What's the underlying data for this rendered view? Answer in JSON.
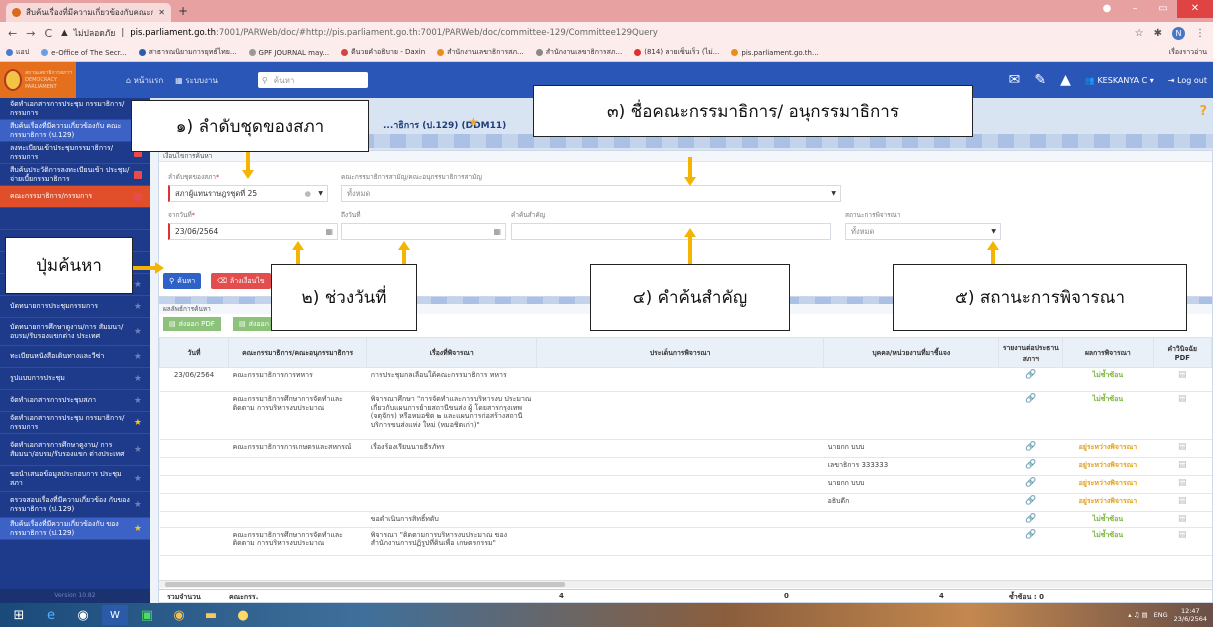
{
  "browser": {
    "tab_title": "สืบค้นเรื่องที่มีความเกี่ยวข้องกับคณะกรร...",
    "new_tab": "+",
    "window_controls": [
      "●",
      "–",
      "▭",
      "✕"
    ],
    "nav": [
      "←",
      "→",
      "C"
    ],
    "security": "ไม่ปลอดภัย",
    "url_host": "pis.parliament.go.th",
    "url_path": ":7001/PARWeb/doc/#http://pis.parliament.go.th:7001/PARWeb/doc/committee-129/Committee129Query",
    "profile": "N",
    "bookmarks": [
      {
        "label": "แอป",
        "color": "#4a7bd0"
      },
      {
        "label": "e-Office of The Secr...",
        "color": "#6aa0e0"
      },
      {
        "label": "สาธารณนิยามการยุทธ์ไทย...",
        "color": "#2a5fb0"
      },
      {
        "label": "GPF JOURNAL may...",
        "color": "#999999"
      },
      {
        "label": "ดีนวยคำอธิบาย - Daxin",
        "color": "#d04444"
      },
      {
        "label": "สำนักงานเลขาธิการสภ...",
        "color": "#e88e1e"
      },
      {
        "label": "สำนักงานเลขาธิการสภ...",
        "color": "#888888"
      },
      {
        "label": "(814) ลายเซ็นเร็ว (ไม่...",
        "color": "#e03030"
      },
      {
        "label": "pis.parliament.go.th...",
        "color": "#e88e1e"
      }
    ],
    "reading_list": "เรื่องราวอ่าน"
  },
  "app_header": {
    "logo_text": [
      "สถานเลขาธิการสภาฯ",
      "DEMOCRACY PARLIAMENT"
    ],
    "nav": [
      "หน้าแรก",
      "ระบบงาน"
    ],
    "search_placeholder": "ค้นหา",
    "user": "KESKANYA C",
    "logout": "Log out"
  },
  "sidebar": {
    "items": [
      {
        "label": "จัดทำเอกสารการประชุม กรรมาธิการ/กรรมการ",
        "badge": "red",
        "style": ""
      },
      {
        "label": "สืบค้นเรื่องที่มีความเกี่ยวข้องกับ คณะกรรมาธิการ (ป.129)",
        "badge": "red",
        "style": "blu"
      },
      {
        "label": "ลงทะเบียนเข้าประชุมกรรมาธิการ/ กรรมการ",
        "badge": "red",
        "style": ""
      },
      {
        "label": "สืบค้นประวัติการลงทะเบียนเข้า ประชุม/จ่ายเบี้ยกรรมาธิการ",
        "badge": "red",
        "style": ""
      },
      {
        "label": "คณะกรรมาธิการ/กรรมการ",
        "badge": "red",
        "style": "act"
      },
      {
        "label": "",
        "badge": "",
        "style": ""
      },
      {
        "label": "",
        "badge": "",
        "style": ""
      },
      {
        "label": "",
        "badge": "",
        "style": ""
      },
      {
        "label": "บัดทนายการประชุมกรรมาธิการ",
        "badge": "star",
        "style": ""
      },
      {
        "label": "บัดทนายการประชุมกรรมการ",
        "badge": "star",
        "style": ""
      },
      {
        "label": "บัดทนายการศึกษาดูงาน/การ สัมมนา/อบรม/รับรองแขกต่าง ประเทศ",
        "badge": "star",
        "style": ""
      },
      {
        "label": "ทะเบียนหนังสือเดินทางและวีซ่า",
        "badge": "star",
        "style": ""
      },
      {
        "label": "รูปแบบการประชุม",
        "badge": "star",
        "style": ""
      },
      {
        "label": "จัดทำเอกสารการประชุมสภา",
        "badge": "star",
        "style": ""
      },
      {
        "label": "จัดทำเอกสารการประชุม กรรมาธิการ/กรรมการ",
        "badge": "gold",
        "style": ""
      },
      {
        "label": "จัดทำเอกสารการศึกษาดูงาน/ การสัมมนา/อบรม/รับรองแขก ต่างประเทศ",
        "badge": "star",
        "style": ""
      },
      {
        "label": "ขอนำเสนอข้อมูลประกอบการ ประชุมสภา",
        "badge": "star",
        "style": ""
      },
      {
        "label": "ตรวจสอบเรื่องที่มีความเกี่ยวข้อง กับของกรรมาธิการ (ป.129)",
        "badge": "star",
        "style": ""
      },
      {
        "label": "สืบค้นเรื่องที่มีความเกี่ยวข้องกับ ของกรรมาธิการ (ป.129)",
        "badge": "gold",
        "style": "blu"
      }
    ],
    "version": "Version 10.82"
  },
  "page": {
    "title": "...าธิการ (ป.129) (DDM11)",
    "help": "?"
  },
  "search": {
    "panel_title": "เงื่อนไขการค้นหา",
    "assembly_label": "ลำดับชุดของสภา",
    "assembly_value": "สภาผู้แทนราษฎรชุดที่ 25",
    "committee_label": "คณะกรรมาธิการสามัญ/คณะอนุกรรมาธิการสามัญ",
    "committee_value": "ทั้งหมด",
    "from_label": "จากวันที่",
    "from_value": "23/06/2564",
    "to_label": "ถึงวันที่",
    "keyword_label": "คำค้นสำคัญ",
    "status_label": "สถานะการพิจารณา",
    "status_value": "ทั้งหมด",
    "search_button": "ค้นหา",
    "clear_button": "ล้างเงื่อนไข"
  },
  "results": {
    "panel_title": "ผลลัพธ์การค้นหา",
    "export_pdf": "ส่งออก PDF",
    "export_other": "ส่งออก",
    "columns": [
      "วันที่",
      "คณะกรรมาธิการ/คณะอนุกรรมาธิการ",
      "เรื่องที่พิจารณา",
      "ประเด็นการพิจารณา",
      "บุคคล/หน่วยงานที่มาชี้แจง",
      "รายงานต่อประธานสภาฯ",
      "ผลการพิจารณา",
      "คำวินิจฉัย"
    ],
    "pdf_sub": "PDF",
    "rows": [
      {
        "date": "23/06/2564",
        "committee": "คณะกรรมาธิการการทหาร",
        "subject": "การประชุมกลเลือนใต้คณะกรรมาธิการ ทหาร",
        "person": "",
        "status": "ไม่ซ้ำซ้อน",
        "tone": "g"
      },
      {
        "date": "",
        "committee": "คณะกรรมาธิการศึกษาการจัดทำและติดตาม การบริหารงบประมาณ",
        "subject": "พิจารณาศึกษา \"การจัดทำและการบริหารงบ ประมาณเกี่ยวกับแผนการย้ายสถานีขนส่ง ผู้ โดยสารกรุงเทพ (จตุจักร) หรือหมอชิต ๒ และแผนการก่อสร้างสถานีบริการขนส่งแห่ง ใหม่ (หมอชิตเก่า)\"",
        "person": "",
        "status": "ไม่ซ้ำซ้อน",
        "tone": "g"
      },
      {
        "date": "",
        "committee": "คณะกรรมาธิการการเกษตรและสหกรณ์",
        "subject": "เรื่องร้องเรียนนายธีรภัทร",
        "person": "นายกก บบบ",
        "status": "อยู่ระหว่างพิจารณา",
        "tone": "o"
      },
      {
        "date": "",
        "committee": "",
        "subject": "",
        "person": "เลขาธิการ 333333",
        "status": "อยู่ระหว่างพิจารณา",
        "tone": "o"
      },
      {
        "date": "",
        "committee": "",
        "subject": "",
        "person": "นายกก บบบ",
        "status": "อยู่ระหว่างพิจารณา",
        "tone": "o"
      },
      {
        "date": "",
        "committee": "",
        "subject": "",
        "person": "อธิบดีก",
        "status": "อยู่ระหว่างพิจารณา",
        "tone": "o"
      },
      {
        "date": "",
        "committee": "",
        "subject": "ขอดำเนินการสิทธิ์ทดับ",
        "person": "",
        "status": "ไม่ซ้ำซ้อน",
        "tone": "g"
      },
      {
        "date": "",
        "committee": "คณะกรรมาธิการศึกษาการจัดทำและติดตาม การบริหารงบประมาณ",
        "subject": "พิจารณา \"ติดตามการบริหารงบประมาณ ของสำนักงานการปฏิรูปที่ดินเพื่อ เกษตรกรรม\"",
        "person": "",
        "status": "ไม่ซ้ำซ้อน",
        "tone": "g"
      }
    ],
    "footer": {
      "label": "รวมจำนวน",
      "committee": "คณะกรร.",
      "n1": "4",
      "n2": "0",
      "n3": "4",
      "dup": "ซ้ำซ้อน : 0"
    }
  },
  "taskbar": {
    "lang": "ENG",
    "time": "12:47",
    "date": "23/6/2564"
  },
  "annotations": {
    "c1": "๑) ลำดับชุดของสภา",
    "c2": "๒) ช่วงวันที่",
    "c3": "๓) ชื่อคณะกรรมาธิการ/ อนุกรรมาธิการ",
    "c4": "๔) คำค้นสำคัญ",
    "c5": "๕) สถานะการพิจารณา",
    "search_btn": "ปุ่มค้นหา",
    "color": "#f5b400"
  }
}
